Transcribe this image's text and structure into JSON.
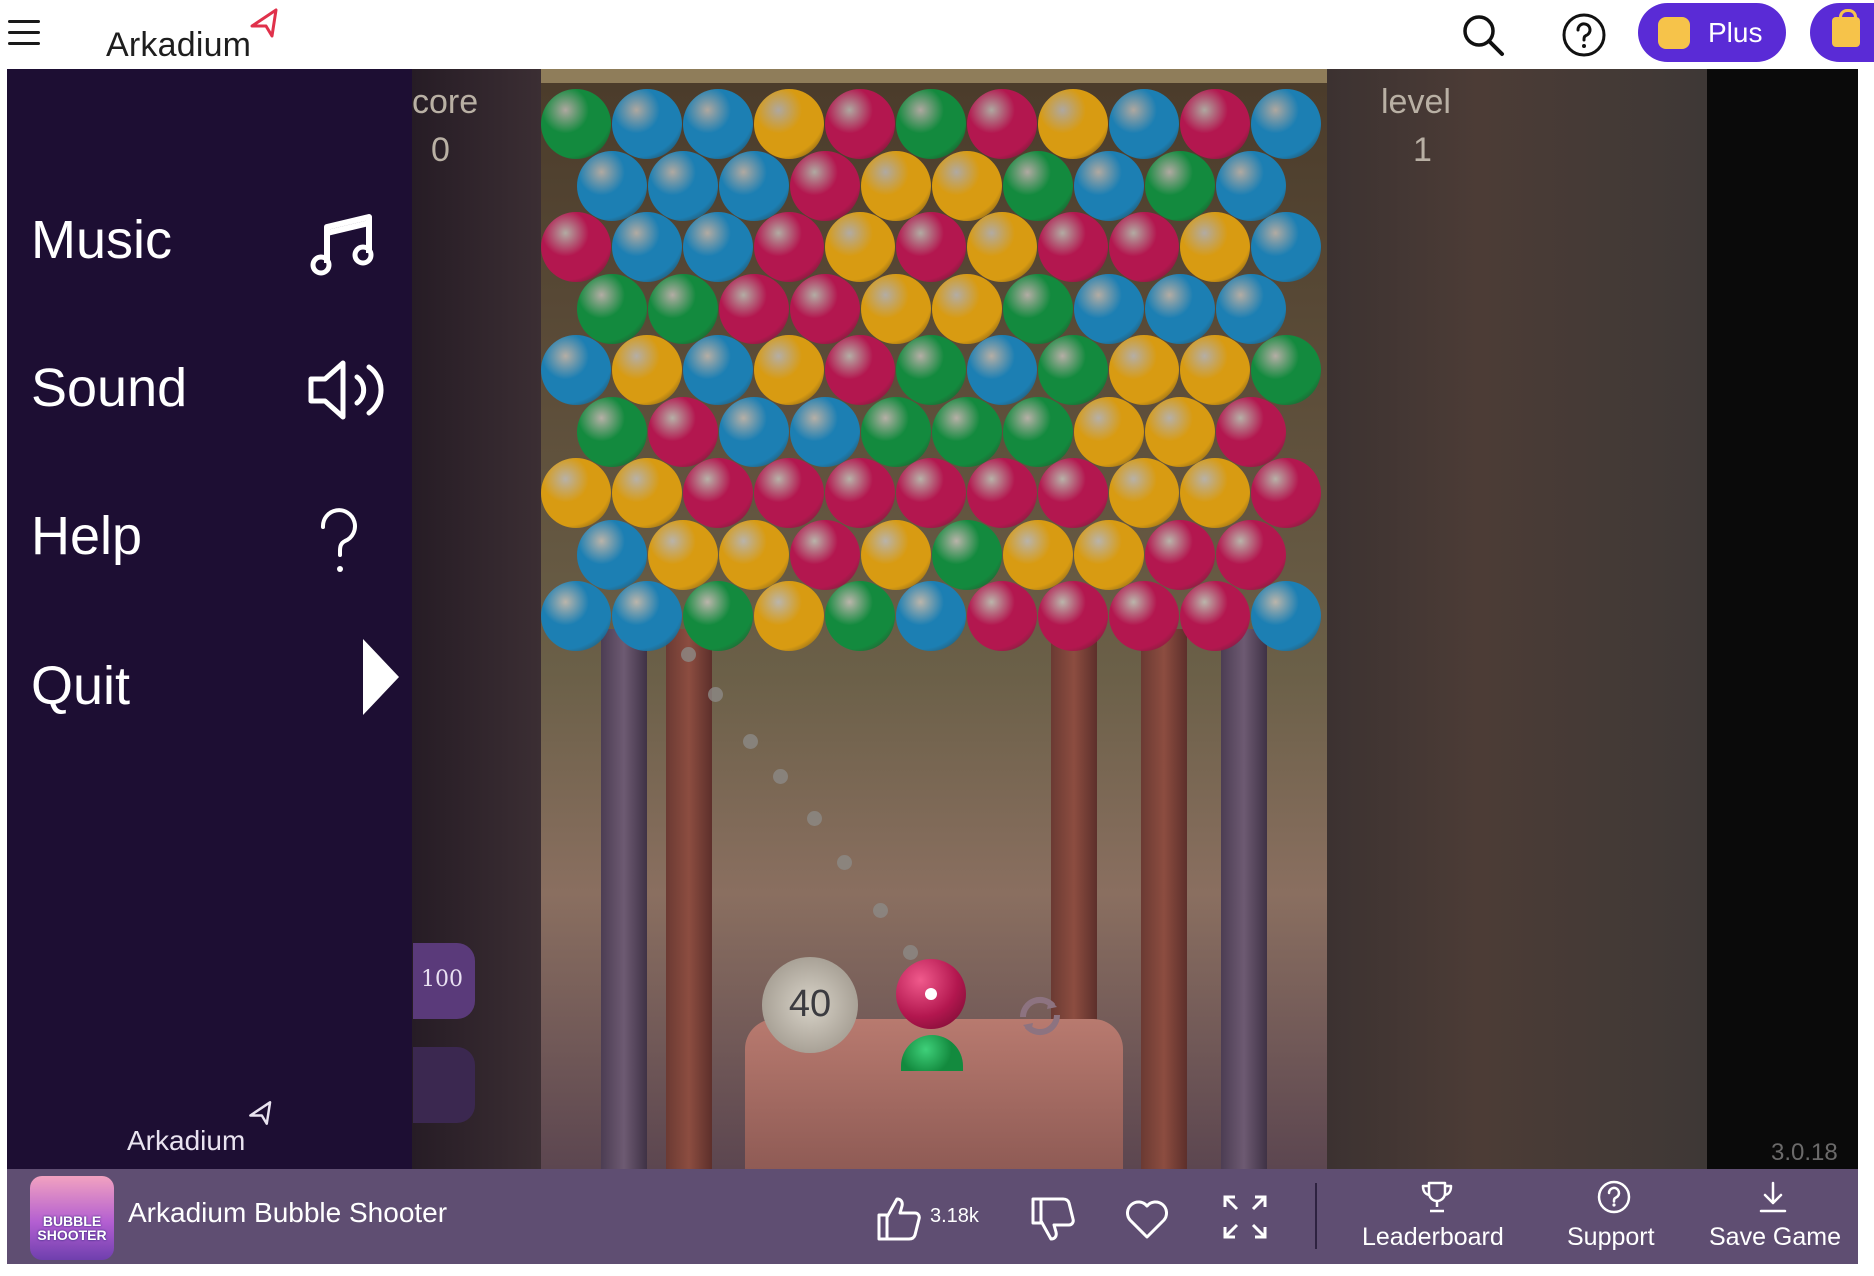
{
  "header": {
    "menu_icon": "hamburger-icon",
    "logo_text": "Arkadium",
    "search_icon": "search-icon",
    "help_icon": "help-circle-icon",
    "plus_label": "Plus",
    "shop_icon": "shopping-bag-icon"
  },
  "game": {
    "score_label": "core",
    "score_value": "0",
    "level_label": "level",
    "level_value": "1",
    "shots_left": "40",
    "side_bonus": "100",
    "version": "3.0.18"
  },
  "side_menu": {
    "items": [
      {
        "label": "Music",
        "icon": "music-note-icon"
      },
      {
        "label": "Sound",
        "icon": "speaker-icon"
      },
      {
        "label": "Help",
        "icon": "question-mark-icon"
      },
      {
        "label": "Quit",
        "icon": "play-triangle-icon"
      }
    ],
    "logo_text": "Arkadium"
  },
  "bottom_bar": {
    "game_title": "Arkadium Bubble Shooter",
    "thumb_text": "BUBBLE SHOOTER",
    "like_count": "3.18k",
    "leaderboard": "Leaderboard",
    "support": "Support",
    "save_game": "Save Game"
  },
  "colors": {
    "header_bg": "#ffffff",
    "plus_bg": "#5a2bd6",
    "side_menu_bg": "#1d0e33",
    "bottom_bar_bg": "#5f4e72",
    "bubble_red": "#b3174f",
    "bubble_blue": "#1c7fb3",
    "bubble_green": "#138a3e",
    "bubble_yellow": "#d89b12"
  },
  "bubble_rows": [
    "G B B Y R G R Y B R B",
    "B B B R Y Y G B G B",
    "R B B R Y R Y R R Y B",
    "G G R R Y Y G B B B",
    "B Y B Y R G B G Y Y G",
    "G R B B G G G Y Y R",
    "Y Y R R R R R R Y Y R",
    "B Y Y R Y G Y Y R R",
    "B B G Y G B R R R R B"
  ]
}
